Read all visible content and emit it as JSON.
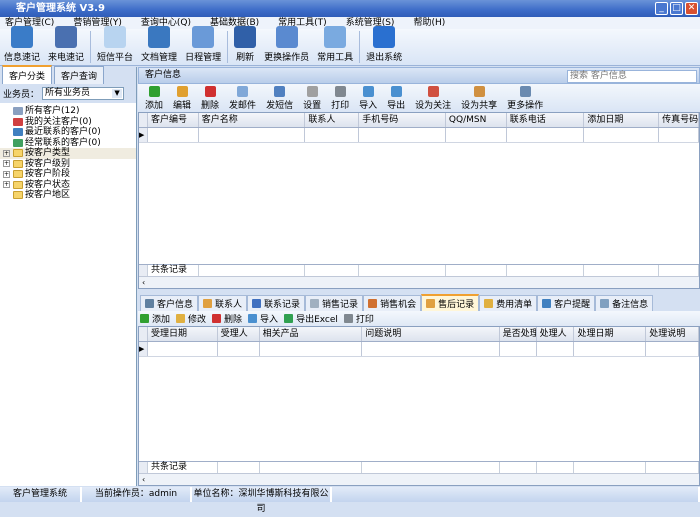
{
  "window": {
    "title": "客户管理系统 V3.9",
    "min": "_",
    "max": "□",
    "close": "✕"
  },
  "menu": [
    "客户管理(C)",
    "营销管理(Y)",
    "查询中心(Q)",
    "基础数据(B)",
    "常用工具(T)",
    "系统管理(S)",
    "帮助(H)"
  ],
  "toolbar": [
    {
      "label": "信息速记",
      "icon": "notebook-pen-icon",
      "color": "#3a7cc8"
    },
    {
      "label": "来电速记",
      "icon": "phone-note-icon",
      "color": "#4a70b0"
    },
    {
      "label": "短信平台",
      "icon": "envelope-icon",
      "color": "#b8d4f0"
    },
    {
      "label": "文档管理",
      "icon": "book-icon",
      "color": "#3a78c0"
    },
    {
      "label": "日程管理",
      "icon": "calendar-icon",
      "color": "#6a9ad8"
    },
    {
      "label": "刷新",
      "icon": "refresh-icon",
      "color": "#3060a8"
    },
    {
      "label": "更换操作员",
      "icon": "id-card-icon",
      "color": "#5a8ad0"
    },
    {
      "label": "常用工具",
      "icon": "wrench-icon",
      "color": "#7aaae0"
    },
    {
      "label": "退出系统",
      "icon": "exit-icon",
      "color": "#2a70d0"
    }
  ],
  "left": {
    "tabs": [
      "客户分类",
      "客户查询"
    ],
    "salesperson_label": "业务员：",
    "salesperson_value": "所有业务员",
    "tree": [
      {
        "label": "所有客户(12)",
        "icon": "customers-icon",
        "color": "#8aa0c0",
        "expand": false
      },
      {
        "label": "我的关注客户(0)",
        "icon": "favorite-icon",
        "color": "#d04040",
        "expand": false
      },
      {
        "label": "最近联系的客户(0)",
        "icon": "user-icon",
        "color": "#4080c0",
        "expand": false
      },
      {
        "label": "经常联系的客户(0)",
        "icon": "user-icon",
        "color": "#40a060",
        "expand": false
      },
      {
        "label": "按客户类型",
        "icon": "folder-icon",
        "expand": true,
        "highlight": true
      },
      {
        "label": "按客户级别",
        "icon": "folder-icon",
        "expand": true
      },
      {
        "label": "按客户阶段",
        "icon": "folder-icon",
        "expand": true
      },
      {
        "label": "按客户状态",
        "icon": "folder-icon",
        "expand": true
      },
      {
        "label": "按客户地区",
        "icon": "folder-icon",
        "expand": false
      }
    ]
  },
  "main": {
    "title": "客户信息",
    "search_placeholder": "搜索 客户信息",
    "toolbar": [
      {
        "label": "添加",
        "icon": "add-icon",
        "color": "#30a030"
      },
      {
        "label": "编辑",
        "icon": "edit-icon",
        "color": "#e0a030"
      },
      {
        "label": "删除",
        "icon": "delete-icon",
        "color": "#d03030"
      },
      {
        "label": "发邮件",
        "icon": "mail-icon",
        "color": "#80a8d8"
      },
      {
        "label": "发短信",
        "icon": "sms-icon",
        "color": "#5080c0"
      },
      {
        "label": "设置",
        "icon": "gear-icon",
        "color": "#a0a0a0"
      },
      {
        "label": "打印",
        "icon": "print-icon",
        "color": "#808890"
      },
      {
        "label": "导入",
        "icon": "import-icon",
        "color": "#4a90d0"
      },
      {
        "label": "导出",
        "icon": "export-icon",
        "color": "#4a90d0"
      },
      {
        "label": "设为关注",
        "icon": "follow-icon",
        "color": "#d05040"
      },
      {
        "label": "设为共享",
        "icon": "share-icon",
        "color": "#d09040"
      },
      {
        "label": "更多操作",
        "icon": "more-icon",
        "color": "#6a8ab0"
      }
    ],
    "columns": [
      "客户编号",
      "客户名称",
      "联系人",
      "手机号码",
      "QQ/MSN",
      "联系电话",
      "添加日期",
      "传真号码"
    ],
    "footer": "共条记录"
  },
  "detail": {
    "tabs": [
      {
        "label": "客户信息",
        "icon": "info-icon",
        "color": "#6080a0"
      },
      {
        "label": "联系人",
        "icon": "contact-icon",
        "color": "#e0a040"
      },
      {
        "label": "联系记录",
        "icon": "record-icon",
        "color": "#4070c0"
      },
      {
        "label": "销售记录",
        "icon": "sales-icon",
        "color": "#a0b0c0"
      },
      {
        "label": "销售机会",
        "icon": "opportunity-icon",
        "color": "#d07030"
      },
      {
        "label": "售后记录",
        "icon": "service-icon",
        "color": "#e0a040",
        "active": true
      },
      {
        "label": "费用清单",
        "icon": "expense-icon",
        "color": "#e0b040"
      },
      {
        "label": "客户提醒",
        "icon": "reminder-icon",
        "color": "#4080c0"
      },
      {
        "label": "备注信息",
        "icon": "note-icon",
        "color": "#80a0c0"
      }
    ],
    "toolbar": [
      {
        "label": "添加",
        "icon": "add-icon",
        "color": "#30a030"
      },
      {
        "label": "修改",
        "icon": "edit-icon",
        "color": "#e0b040"
      },
      {
        "label": "删除",
        "icon": "delete-icon",
        "color": "#d03030"
      },
      {
        "label": "导入",
        "icon": "import-icon",
        "color": "#4a90d0"
      },
      {
        "label": "导出Excel",
        "icon": "excel-icon",
        "color": "#30a050"
      },
      {
        "label": "打印",
        "icon": "print-icon",
        "color": "#808890"
      }
    ],
    "columns": [
      "受理日期",
      "受理人",
      "相关产品",
      "问题说明",
      "是否处理",
      "处理人",
      "处理日期",
      "处理说明"
    ],
    "footer": "共条记录"
  },
  "status": [
    "客户管理系统",
    "当前操作员：admin",
    "单位名称：深圳华博斯科技有限公司",
    ""
  ]
}
